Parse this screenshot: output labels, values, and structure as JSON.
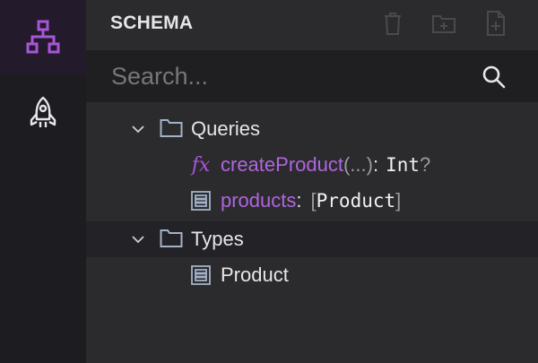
{
  "sidebar": {
    "items": [
      {
        "icon": "schema-hierarchy-icon",
        "active": true
      },
      {
        "icon": "rocket-icon",
        "active": false
      }
    ]
  },
  "panel": {
    "title": "SCHEMA",
    "actions": [
      {
        "icon": "trash-icon"
      },
      {
        "icon": "new-folder-icon"
      },
      {
        "icon": "new-file-icon"
      }
    ]
  },
  "search": {
    "placeholder": "Search...",
    "value": ""
  },
  "tree": {
    "queries": {
      "label": "Queries",
      "expanded": true,
      "items": [
        {
          "icon": "function-icon",
          "icon_text": "fx",
          "name": "createProduct",
          "args": "(...)",
          "colon": ":",
          "type": "Int",
          "suffix": "?"
        },
        {
          "icon": "type-list-icon",
          "name": "products",
          "colon": ":",
          "open_bracket": "[",
          "type": "Product",
          "close_bracket": "]"
        }
      ]
    },
    "types": {
      "label": "Types",
      "expanded": true,
      "items": [
        {
          "icon": "type-list-icon",
          "name": "Product"
        }
      ]
    }
  },
  "colors": {
    "accent": "#a855d8",
    "sidebar_bg": "#1d1c20",
    "panel_bg": "#2b2b2e",
    "search_bg": "#1f1f22"
  }
}
